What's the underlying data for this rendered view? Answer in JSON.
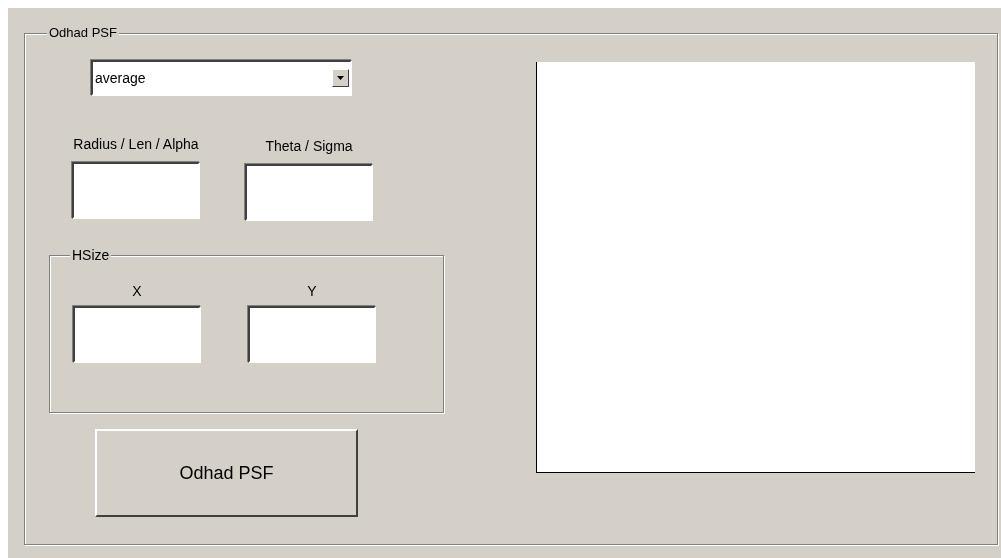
{
  "panel": {
    "title": "Odhad PSF",
    "dropdown": {
      "value": "average"
    },
    "parameters": [
      {
        "label": "Radius / Len / Alpha"
      },
      {
        "label": "Theta / Sigma"
      }
    ],
    "hsize": {
      "title": "HSize",
      "fields": [
        {
          "label": "X"
        },
        {
          "label": "Y"
        }
      ]
    },
    "button": {
      "label": "Odhad PSF"
    }
  }
}
